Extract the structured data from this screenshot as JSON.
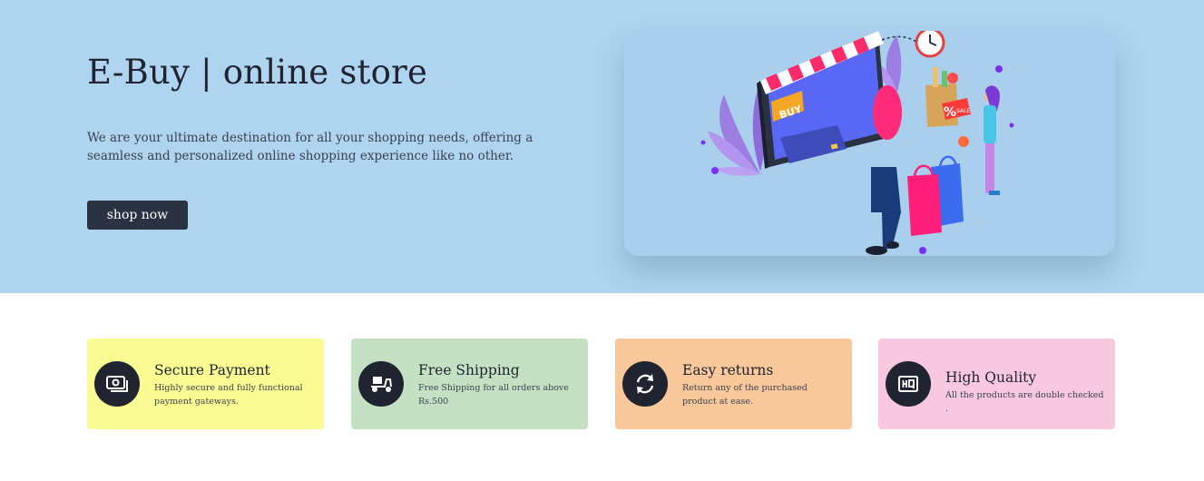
{
  "hero": {
    "title": "E-Buy | online store",
    "description": "We are your ultimate destination for all your shopping needs, offering a seamless and personalized online shopping experience like no other.",
    "cta_label": "shop now",
    "background_color": "#aed4ef",
    "illustration": {
      "semantic": "online-shopping-illustration",
      "storefront_sign": "BUY",
      "tag_text": "SALE",
      "tag_symbol": "%"
    }
  },
  "features": [
    {
      "title": "Secure Payment",
      "description": "Highly secure and fully functional payment gateways.",
      "icon": "payment-icon",
      "color": "#fafb92"
    },
    {
      "title": "Free Shipping",
      "description": "Free Shipping for all orders above Rs.500",
      "icon": "delivery-scooter-icon",
      "color": "#c4e1c4"
    },
    {
      "title": "Easy returns",
      "description": "Return any of the purchased product at ease.",
      "icon": "returns-icon",
      "color": "#f8c79a"
    },
    {
      "title": "High Quality",
      "description": "All the products are double checked .",
      "icon": "hq-badge-icon",
      "color": "#f7c8de"
    }
  ],
  "colors": {
    "dark": "#1f2430",
    "button": "#2b3243",
    "accent_purple": "#7b2ff7",
    "accent_pink": "#ff1e7a"
  }
}
